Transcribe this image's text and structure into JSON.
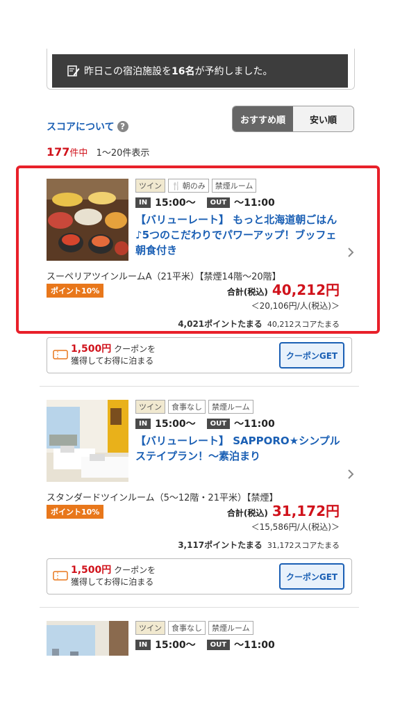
{
  "notice": {
    "pre": "昨日この宿泊施設を",
    "count": "16名",
    "post": "が予約しました。"
  },
  "score_link": "スコアについて",
  "sort": {
    "recommended": "おすすめ順",
    "cheap": "安い順"
  },
  "result": {
    "total": "177",
    "unit": "件中",
    "range": "1〜20件表示"
  },
  "plans": [
    {
      "tags": [
        "ツイン",
        "朝のみ",
        "禁煙ルーム"
      ],
      "checkin_label": "IN",
      "checkin": "15:00〜",
      "checkout_label": "OUT",
      "checkout": "〜11:00",
      "title": "【バリューレート】 もっと北海道朝ごはん♪5つのこだわりでパワーアップ！ブッフェ朝食付き",
      "room": "スーペリアツインルームA（21平米）【禁煙14階〜20階】",
      "points_badge": "ポイント10%",
      "total_label": "合計(税込)",
      "price": "40,212円",
      "per_person": "＜20,106円/人(税込)＞",
      "points_amount": "4,021",
      "points_text": "ポイントたまる",
      "score_amount": "40,212",
      "score_text": "スコアたまる"
    },
    {
      "tags": [
        "ツイン",
        "食事なし",
        "禁煙ルーム"
      ],
      "checkin_label": "IN",
      "checkin": "15:00〜",
      "checkout_label": "OUT",
      "checkout": "〜11:00",
      "title": "【バリューレート】 SAPPORO★シンプルステイプラン！〜素泊まり",
      "room": "スタンダードツインルーム（5〜12階・21平米）【禁煙】",
      "points_badge": "ポイント10%",
      "total_label": "合計(税込)",
      "price": "31,172円",
      "per_person": "＜15,586円/人(税込)＞",
      "points_amount": "3,117",
      "points_text": "ポイントたまる",
      "score_amount": "31,172",
      "score_text": "スコアたまる"
    },
    {
      "tags": [
        "ツイン",
        "食事なし",
        "禁煙ルーム"
      ],
      "checkin_label": "IN",
      "checkin": "15:00〜",
      "checkout_label": "OUT",
      "checkout": "〜11:00"
    }
  ],
  "coupon": {
    "amount": "1,500円",
    "line1": "クーポンを",
    "line2": "獲得してお得に泊まる",
    "button": "クーポンGET"
  },
  "colors": {
    "accent_red": "#d0121b",
    "link_blue": "#1a5fb4",
    "points_orange": "#e8771b",
    "highlight_red": "#e8202a"
  }
}
